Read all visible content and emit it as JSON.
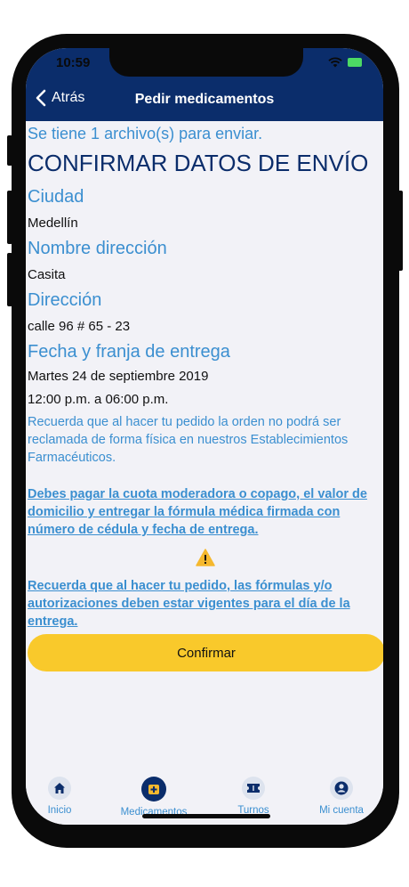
{
  "status": {
    "time": "10:59"
  },
  "nav": {
    "back_label": "Atrás",
    "title": "Pedir medicamentos"
  },
  "files_note": "Se tiene 1 archivo(s) para enviar.",
  "heading": "CONFIRMAR DATOS DE ENVÍO",
  "fields": {
    "city_label": "Ciudad",
    "city_value": "Medellín",
    "address_name_label": "Nombre dirección",
    "address_name_value": "Casita",
    "address_label": "Dirección",
    "address_value": "calle 96 # 65 - 23",
    "delivery_label": "Fecha y franja de entrega",
    "delivery_date": "Martes 24 de septiembre 2019",
    "delivery_slot": "12:00 p.m. a 06:00 p.m."
  },
  "notice_text": "Recuerda que al hacer tu pedido la orden no podrá ser reclamada de forma física en nuestros Establecimientos Farmacéuticos.",
  "payment_link": "Debes pagar la cuota moderadora o copago, el valor de domicilio y entregar la fórmula médica firmada con número de cédula y fecha de entrega.",
  "validity_link": "Recuerda que al hacer tu pedido, las fórmulas y/o autorizaciones deben estar vigentes para el día de la entrega.",
  "confirm_label": "Confirmar",
  "tabs": [
    {
      "label": "Inicio",
      "icon": "home-icon"
    },
    {
      "label": "Medicamentos",
      "icon": "medication-icon"
    },
    {
      "label": "Turnos",
      "icon": "ticket-icon"
    },
    {
      "label": "Mi cuenta",
      "icon": "account-icon"
    }
  ],
  "colors": {
    "primary": "#0b2d6b",
    "accent": "#3b8fd0",
    "button": "#f9c92b",
    "warning": "#f5b82e"
  }
}
